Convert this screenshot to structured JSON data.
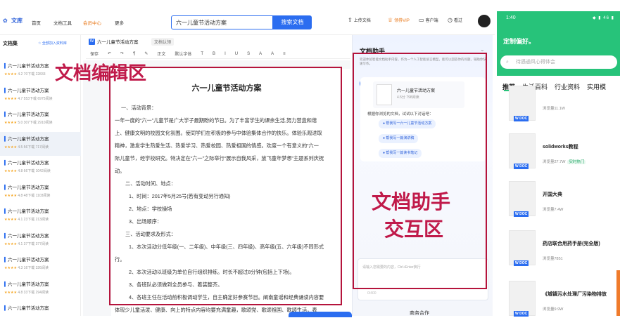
{
  "topnav": {
    "logo": "文库",
    "links": [
      "首页",
      "文档工具",
      "会员中心",
      "更多"
    ],
    "search_value": "六一儿童节活动方案",
    "search_button": "搜索文档",
    "icons": [
      {
        "label": "上传文档",
        "icon": "upload-icon"
      },
      {
        "label": "领券VIP",
        "icon": "vip-icon"
      },
      {
        "label": "客户端",
        "icon": "client-icon"
      },
      {
        "label": "看过",
        "icon": "history-icon"
      }
    ]
  },
  "sidebar": {
    "title": "文档集",
    "join": "全部加入资料库",
    "items": [
      {
        "title": "六一儿童节活动方案",
        "rating": "4.2",
        "downloads": "70下载",
        "views": "22833"
      },
      {
        "title": "六一儿童节活动方案",
        "rating": "4.7",
        "downloads": "553下载",
        "views": "6975阅读"
      },
      {
        "title": "六一儿童节活动方案",
        "rating": "5.0",
        "downloads": "307下载",
        "views": "2910阅读"
      },
      {
        "title": "六一儿童节活动方案",
        "rating": "4.5",
        "downloads": "56下载",
        "views": "717阅读"
      },
      {
        "title": "六一儿童节活动方案",
        "rating": "4.8",
        "downloads": "66下载",
        "views": "1042阅读"
      },
      {
        "title": "六一儿童节活动方案",
        "rating": "4.8",
        "downloads": "48下载",
        "views": "1103阅读"
      },
      {
        "title": "六一儿童节活动方案",
        "rating": "4.1",
        "downloads": "23下载",
        "views": "213阅读"
      },
      {
        "title": "六一儿童节活动方案",
        "rating": "4.1",
        "downloads": "37下载",
        "views": "377阅读"
      },
      {
        "title": "六一儿童节活动方案",
        "rating": "4.3",
        "downloads": "16下载",
        "views": "326阅读"
      },
      {
        "title": "六一儿童节活动方案",
        "rating": "4.8",
        "downloads": "33下载",
        "views": "294阅读"
      },
      {
        "title": "六一儿童节活动方案",
        "rating": "",
        "downloads": "",
        "views": ""
      }
    ]
  },
  "doc": {
    "tab_title": "六一儿童节活动方案",
    "tab_secondary": "文档认领",
    "toolbar": [
      "保存",
      "↶",
      "↷",
      "¶",
      "✎",
      "正文",
      "默认字体",
      "T",
      "B",
      "I",
      "U",
      "S",
      "A",
      "A",
      "≡"
    ],
    "title": "六一儿童节活动方案",
    "paragraphs": [
      "一、活动背景：",
      "一年一度的“六一”儿童节是广大学子最期盼的节日。为了丰富学生的课余生活,努力营造和谐",
      "上、健康文明的校园文化氛围。使同学们在积极的参与中体验集体合作的快乐。体验乐观进取",
      "精神，激发学生热爱生活、热爱学习、热爱校园、热爱祖国的情感。欢度一个有意义的“六一",
      "际儿童节，经学校研究。特决定在“六一”之际举行“展示自我风采，放飞童年梦想”主题系列庆祝",
      "动。",
      "二、活动时间、地点：",
      "1、时间：2017年5月25号(若有变动另行通知)",
      "2、地点：学校操场",
      "3、出场顺序：",
      "三、活动要求及形式：",
      "1、本次活动分低年级(一、二年级)、中年级(三、四年级)、高年级(五、六年级)不同形式",
      "行。",
      "2、本次活动以班级为单位自行组织排练。时长不超过8分钟(包括上下场)。",
      "3、各班队必须做到全员参与、着装整齐。",
      "4、各班主任在活动前积极调动学生，自主确定好参赛节目。阐南童谣和经典诵读内容要",
      "体现少儿童活泼、健康、向上的特点内容均要充满童趣，歌颂党、歌颂祖国、歌颂生活，表"
    ]
  },
  "labels": {
    "edit_area": "文档编辑区",
    "assistant_line1": "文档助手",
    "assistant_line2": "交互区"
  },
  "assistant": {
    "title": "文档助手",
    "description": "欢迎体验智能文档助手内容。作为一个人工智能语言模型，能可以回答你的问题，辅助你快速写作。",
    "file_name": "六一儿童节活动方案",
    "file_meta": "4.5分  798阅读",
    "prompt": "根据你浏览的文档，试试以下对话吧：",
    "suggestions": [
      "帮我写一六一儿童节活动方案",
      "帮我写一篇演讲稿",
      "帮我写一篇读书笔记"
    ],
    "input_placeholder": "请输入您需要的内容，Ctrl+Enter换行",
    "counter": "0/400",
    "business": "商务合作"
  },
  "phone": {
    "time": "1:40",
    "status": "◆ ▮ 46 ▮",
    "greeting": "定制偏好。",
    "search_placeholder": "待遇通风心得体会",
    "tabs": [
      "推荐",
      "生活百科",
      "行业资料",
      "实用模"
    ],
    "items": [
      {
        "title": "",
        "views": "浏览量11.1W",
        "badge": ""
      },
      {
        "title": "solidworks教程",
        "views": "浏览量27.7W",
        "badge": "实时热门"
      },
      {
        "title": "开国大典",
        "views": "浏览量7.4W",
        "badge": ""
      },
      {
        "title": "药店联合用药手册(完全版)",
        "views": "浏览量7851",
        "badge": ""
      },
      {
        "title": "《城镇污水处理厂污染物排放",
        "views": "浏览量9.9W",
        "badge": ""
      }
    ]
  },
  "colors": {
    "brand_blue": "#2b6df0",
    "phone_green": "#27c37a",
    "annotation_red": "#b5143c"
  }
}
